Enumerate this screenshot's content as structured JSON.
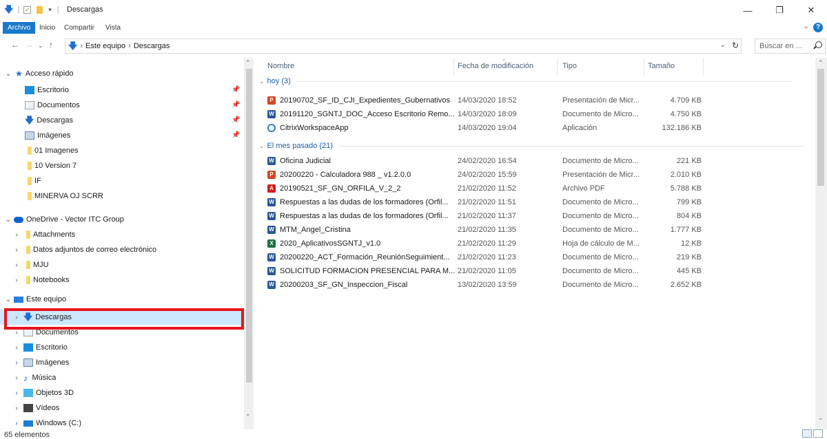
{
  "window": {
    "title": "Descargas",
    "minimize": "—",
    "maximize": "❐",
    "close": "✕"
  },
  "ribbon": {
    "tabs": [
      "Archivo",
      "Inicio",
      "Compartir",
      "Vista"
    ],
    "help": "?"
  },
  "address": {
    "segments": [
      "Este equipo",
      "Descargas"
    ],
    "search_placeholder": "Buscar en ..."
  },
  "nav": {
    "quick_access": "Acceso rápido",
    "quick_items": [
      {
        "label": "Escritorio",
        "icon": "desktop-icon"
      },
      {
        "label": "Documentos",
        "icon": "documents-icon"
      },
      {
        "label": "Descargas",
        "icon": "downloads-icon"
      },
      {
        "label": "Imágenes",
        "icon": "pictures-icon"
      },
      {
        "label": "01 Imagenes",
        "icon": "folder-icon"
      },
      {
        "label": "10 Version 7",
        "icon": "folder-icon"
      },
      {
        "label": "IF",
        "icon": "folder-icon"
      },
      {
        "label": "MINERVA OJ SCRR",
        "icon": "folder-icon"
      }
    ],
    "onedrive": "OneDrive - Vector ITC Group",
    "onedrive_items": [
      {
        "label": "Attachments"
      },
      {
        "label": "Datos adjuntos de correo electrónico"
      },
      {
        "label": "MJU"
      },
      {
        "label": "Notebooks"
      }
    ],
    "this_pc": "Este equipo",
    "pc_items": [
      {
        "label": "Descargas",
        "icon": "downloads-icon"
      },
      {
        "label": "Documentos",
        "icon": "documents-icon"
      },
      {
        "label": "Escritorio",
        "icon": "desktop-icon"
      },
      {
        "label": "Imágenes",
        "icon": "pictures-icon"
      },
      {
        "label": "Música",
        "icon": "music-icon"
      },
      {
        "label": "Objetos 3D",
        "icon": "3d-objects-icon"
      },
      {
        "label": "Vídeos",
        "icon": "videos-icon"
      },
      {
        "label": "Windows (C:)",
        "icon": "drive-icon"
      }
    ]
  },
  "columns": {
    "name": "Nombre",
    "date": "Fecha de modificación",
    "type": "Tipo",
    "size": "Tamaño"
  },
  "groups": [
    {
      "label": "hoy (3)",
      "files": [
        {
          "name": "20190702_SF_ID_CJI_Expedientes_Gubernativos",
          "date": "14/03/2020 18:52",
          "type": "Presentación de Micr...",
          "size": "4.709 KB",
          "kind": "ppt"
        },
        {
          "name": "20191120_SGNTJ_DOC_Acceso Escritorio Remo...",
          "date": "14/03/2020 18:09",
          "type": "Documento de Micro...",
          "size": "4.750 KB",
          "kind": "word"
        },
        {
          "name": "CitrixWorkspaceApp",
          "date": "14/03/2020 19:04",
          "type": "Aplicación",
          "size": "132.186 KB",
          "kind": "app"
        }
      ]
    },
    {
      "label": "El mes pasado (21)",
      "files": [
        {
          "name": "Oficina Judicial",
          "date": "24/02/2020 16:54",
          "type": "Documento de Micro...",
          "size": "221 KB",
          "kind": "word"
        },
        {
          "name": "20200220 - Calculadora 988 _ v1.2.0.0",
          "date": "24/02/2020 15:59",
          "type": "Presentación de Micr...",
          "size": "2.010 KB",
          "kind": "ppt"
        },
        {
          "name": "20190521_SF_GN_ORFILA_V_2_2",
          "date": "21/02/2020 11:52",
          "type": "Archivo PDF",
          "size": "5.788 KB",
          "kind": "pdf"
        },
        {
          "name": "Respuestas a las dudas de los formadores (Orfil...",
          "date": "21/02/2020 11:51",
          "type": "Documento de Micro...",
          "size": "799 KB",
          "kind": "word"
        },
        {
          "name": "Respuestas a las dudas de los formadores (Orfil...",
          "date": "21/02/2020 11:37",
          "type": "Documento de Micro...",
          "size": "804 KB",
          "kind": "word"
        },
        {
          "name": "MTM_Angel_Cristina",
          "date": "21/02/2020 11:35",
          "type": "Documento de Micro...",
          "size": "1.777 KB",
          "kind": "word"
        },
        {
          "name": "2020_AplicativosSGNTJ_v1.0",
          "date": "21/02/2020 11:29",
          "type": "Hoja de cálculo de M...",
          "size": "12 KB",
          "kind": "xls"
        },
        {
          "name": "20200220_ACT_Formación_ReuniónSeguimient...",
          "date": "21/02/2020 11:23",
          "type": "Documento de Micro...",
          "size": "219 KB",
          "kind": "word"
        },
        {
          "name": "SOLICITUD FORMACION PRESENCIAL PARA M...",
          "date": "21/02/2020 11:05",
          "type": "Documento de Micro...",
          "size": "445 KB",
          "kind": "word"
        },
        {
          "name": "20200203_SF_GN_Inspeccion_Fiscal",
          "date": "13/02/2020 13:59",
          "type": "Documento de Micro...",
          "size": "2.652 KB",
          "kind": "word"
        }
      ]
    }
  ],
  "status": {
    "count": "65 elementos"
  },
  "colors": {
    "accent": "#1979ca",
    "selection": "#cce8ff",
    "highlight": "#e8141e"
  }
}
